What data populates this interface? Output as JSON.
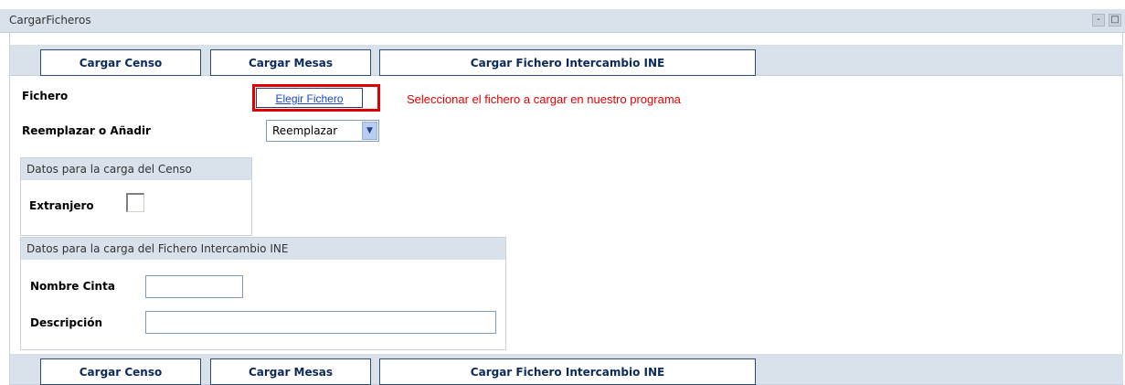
{
  "window": {
    "title": "CargarFicheros",
    "minimize_glyph": "-",
    "maximize_glyph": "□"
  },
  "toolbar_top": {
    "cargar_censo": "Cargar Censo",
    "cargar_mesas": "Cargar Mesas",
    "cargar_ine": "Cargar Fichero Intercambio INE"
  },
  "form": {
    "fichero_label": "Fichero",
    "elegir_label": "Elegir Fichero",
    "hint": "Seleccionar el fichero a cargar en nuestro programa",
    "reemplazar_label": "Reemplazar o Añadir",
    "reemplazar_value": "Reemplazar",
    "dropdown_arrow": "▼"
  },
  "censo_group": {
    "legend": "Datos para la carga del Censo",
    "extranjero_label": "Extranjero",
    "extranjero_checked": false
  },
  "ine_group": {
    "legend": "Datos para la carga del Fichero Intercambio INE",
    "nombre_cinta_label": "Nombre Cinta",
    "nombre_cinta_value": "",
    "descripcion_label": "Descripción",
    "descripcion_value": ""
  },
  "toolbar_bottom": {
    "cargar_censo": "Cargar Censo",
    "cargar_mesas": "Cargar Mesas",
    "cargar_ine": "Cargar Fichero Intercambio INE"
  },
  "colors": {
    "header_bg": "#d9e1ea",
    "button_border": "#2d4b78",
    "hint_red": "#e60000",
    "highlight_red": "#e00000"
  }
}
